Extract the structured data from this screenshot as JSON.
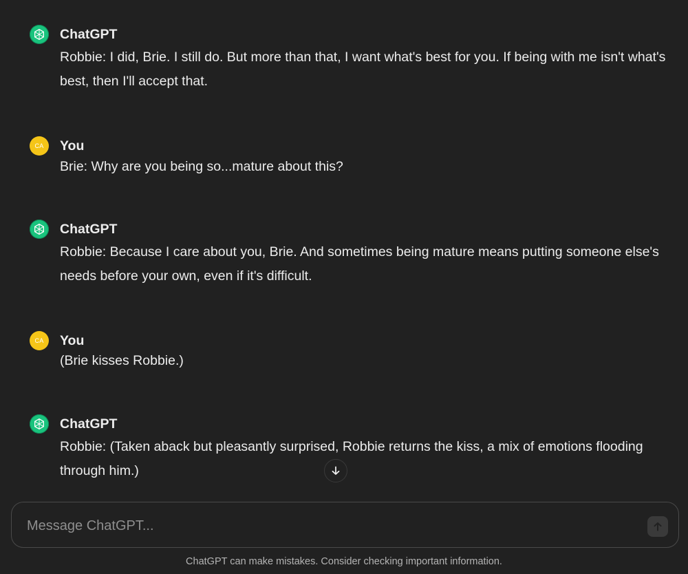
{
  "thread": {
    "messages": [
      {
        "author": "ChatGPT",
        "role": "assistant",
        "text": "Robbie: I did, Brie. I still do. But more than that, I want what's best for you. If being with me isn't what's best, then I'll accept that."
      },
      {
        "author": "You",
        "role": "user",
        "avatar_initials": "CA",
        "text": "Brie: Why are you being so...mature about this?"
      },
      {
        "author": "ChatGPT",
        "role": "assistant",
        "text": "Robbie: Because I care about you, Brie. And sometimes being mature means putting someone else's needs before your own, even if it's difficult."
      },
      {
        "author": "You",
        "role": "user",
        "avatar_initials": "CA",
        "text": "(Brie kisses Robbie.)"
      },
      {
        "author": "ChatGPT",
        "role": "assistant",
        "text": "Robbie: (Taken aback but pleasantly surprised, Robbie returns the kiss, a mix of emotions flooding through him.)"
      }
    ]
  },
  "composer": {
    "placeholder": "Message ChatGPT..."
  },
  "footer": {
    "note": "ChatGPT can make mistakes. Consider checking important information."
  },
  "icons": {
    "assistant_avatar": "openai-logo-icon",
    "scroll": "arrow-down-icon",
    "send": "arrow-up-icon"
  },
  "colors": {
    "background": "#212121",
    "assistant_avatar": "#19c37d",
    "user_avatar": "#f5c518",
    "text": "#ececec",
    "muted": "#b4b4b4"
  }
}
